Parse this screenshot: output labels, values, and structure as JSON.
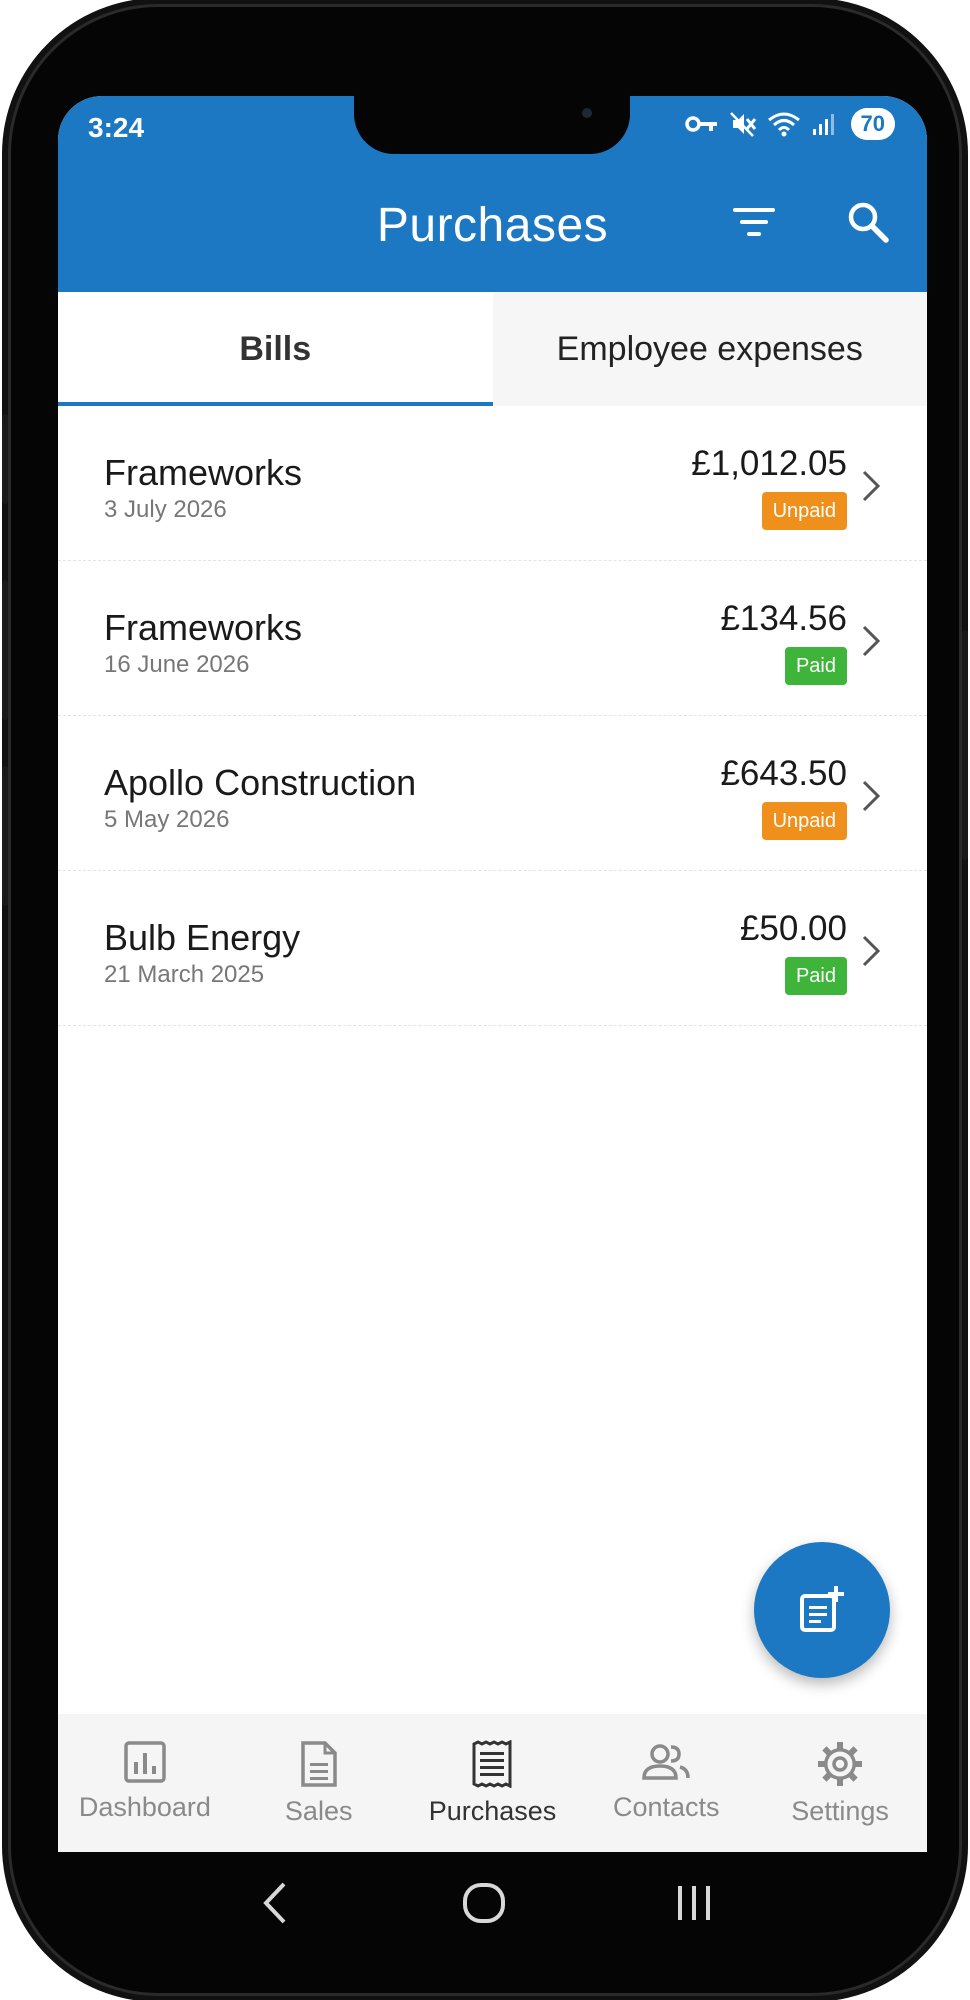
{
  "status_bar": {
    "time": "3:24",
    "battery": "70",
    "icons": [
      "vpn-key-icon",
      "mute-icon",
      "wifi-icon",
      "signal-icon"
    ]
  },
  "app_bar": {
    "title": "Purchases",
    "actions": [
      "filter-icon",
      "search-icon"
    ]
  },
  "tabs": [
    {
      "label": "Bills",
      "active": true
    },
    {
      "label": "Employee expenses",
      "active": false
    }
  ],
  "bills": [
    {
      "name": "Frameworks",
      "date": "3 July 2026",
      "amount": "£1,012.05",
      "status": "Unpaid",
      "status_color": "#f0901c"
    },
    {
      "name": "Frameworks",
      "date": "16 June 2026",
      "amount": "£134.56",
      "status": "Paid",
      "status_color": "#3fb43a"
    },
    {
      "name": "Apollo Construction",
      "date": "5 May 2026",
      "amount": "£643.50",
      "status": "Unpaid",
      "status_color": "#f0901c"
    },
    {
      "name": "Bulb Energy",
      "date": "21 March 2025",
      "amount": "£50.00",
      "status": "Paid",
      "status_color": "#3fb43a"
    }
  ],
  "fab": {
    "icon": "add-bill-icon"
  },
  "bottom_nav": [
    {
      "label": "Dashboard",
      "icon": "dashboard-icon",
      "active": false
    },
    {
      "label": "Sales",
      "icon": "document-icon",
      "active": false
    },
    {
      "label": "Purchases",
      "icon": "receipt-icon",
      "active": true
    },
    {
      "label": "Contacts",
      "icon": "people-icon",
      "active": false
    },
    {
      "label": "Settings",
      "icon": "gear-icon",
      "active": false
    }
  ],
  "colors": {
    "brand": "#1c78c2",
    "unpaid": "#f0901c",
    "paid": "#3fb43a"
  }
}
